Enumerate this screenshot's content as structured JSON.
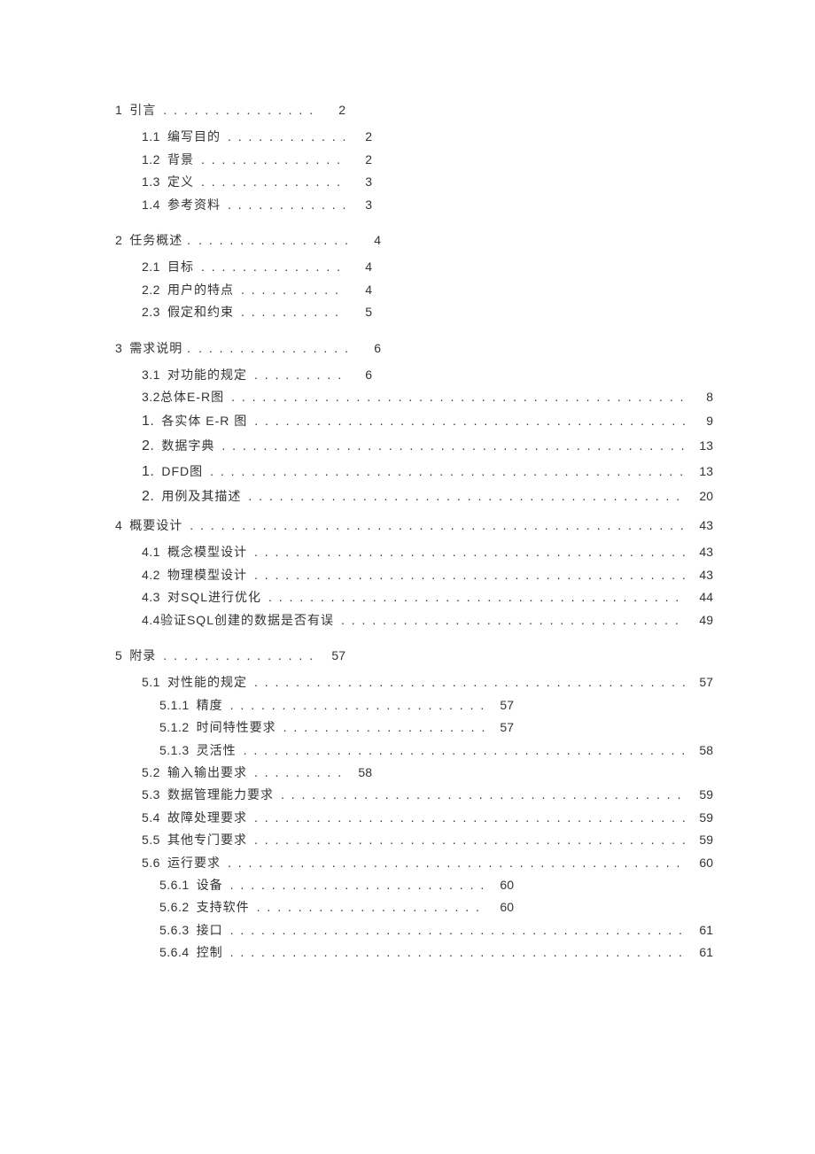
{
  "toc": [
    {
      "level": 0,
      "width": "short",
      "num": "1",
      "title": "引言",
      "page": "2",
      "gap": ""
    },
    {
      "level": 1,
      "width": "short",
      "num": "1.1",
      "title": "编写目的",
      "page": "2",
      "gap": "sub"
    },
    {
      "level": 1,
      "width": "short",
      "num": "1.2",
      "title": "背景",
      "page": "2",
      "gap": ""
    },
    {
      "level": 1,
      "width": "short",
      "num": "1.3",
      "title": "定义",
      "page": "3",
      "gap": ""
    },
    {
      "level": 1,
      "width": "short",
      "num": "1.4",
      "title": "参考资料",
      "page": "3",
      "gap": ""
    },
    {
      "level": 0,
      "width": "short2",
      "num": "2",
      "title": "任务概述 .",
      "page": "4",
      "gap": "section"
    },
    {
      "level": 1,
      "width": "short",
      "num": "2.1",
      "title": "目标",
      "page": "4",
      "gap": "sub"
    },
    {
      "level": 1,
      "width": "short",
      "num": "2.2",
      "title": "用户的特点",
      "page": "4",
      "gap": ""
    },
    {
      "level": 1,
      "width": "short",
      "num": "2.3",
      "title": "假定和约束",
      "page": "5",
      "gap": ""
    },
    {
      "level": 0,
      "width": "short2",
      "num": "3",
      "title": "需求说明 .",
      "page": "6",
      "gap": "section"
    },
    {
      "level": 1,
      "width": "short",
      "num": "3.1",
      "title": "对功能的规定",
      "page": "6",
      "gap": "sub"
    },
    {
      "level": 1,
      "width": "full",
      "num": "3.2",
      "title": "总体E-R图",
      "nospace": true,
      "page": "8",
      "gap": ""
    },
    {
      "level": 1,
      "width": "full",
      "num": "1.",
      "title": "各实体 E-R 图",
      "page": "9",
      "gap": "",
      "big": true
    },
    {
      "level": 1,
      "width": "full",
      "num": "2.",
      "title": "数据字典",
      "page": "13",
      "gap": "",
      "big": true
    },
    {
      "level": 1,
      "width": "full",
      "num": "1.",
      "title": "DFD图",
      "page": "13",
      "gap": "",
      "big": true
    },
    {
      "level": 1,
      "width": "full",
      "num": "2.",
      "title": "用例及其描述",
      "page": "20",
      "gap": "",
      "big": true
    },
    {
      "level": 0,
      "width": "full",
      "num": "4",
      "title": "概要设计",
      "page": "43",
      "gap": "sub"
    },
    {
      "level": 1,
      "width": "full",
      "num": "4.1",
      "title": "概念模型设计",
      "page": "43",
      "gap": "sub"
    },
    {
      "level": 1,
      "width": "full",
      "num": "4.2",
      "title": "物理模型设计",
      "page": "43",
      "gap": ""
    },
    {
      "level": 1,
      "width": "full",
      "num": "4.3",
      "title": "对SQL进行优化",
      "page": "44",
      "gap": ""
    },
    {
      "level": 1,
      "width": "full",
      "num": "4.4",
      "title": "验证SQL创建的数据是否有误",
      "nospace": true,
      "page": "49",
      "gap": ""
    },
    {
      "level": 0,
      "width": "short",
      "num": "5",
      "title": "附录",
      "page": "57",
      "gap": "section"
    },
    {
      "level": 1,
      "width": "full",
      "num": "5.1",
      "title": "对性能的规定",
      "page": "57",
      "gap": "sub"
    },
    {
      "level": 2,
      "width": "mid",
      "num": "5.1.1",
      "title": "精度",
      "page": "57",
      "gap": ""
    },
    {
      "level": 2,
      "width": "mid",
      "num": "5.1.2",
      "title": "时间特性要求",
      "page": "57",
      "gap": ""
    },
    {
      "level": 2,
      "width": "full",
      "num": "5.1.3",
      "title": "灵活性",
      "page": "58",
      "gap": ""
    },
    {
      "level": 1,
      "width": "short",
      "num": "5.2",
      "title": "输入输出要求",
      "page": "58",
      "gap": ""
    },
    {
      "level": 1,
      "width": "full",
      "num": "5.3",
      "title": "数据管理能力要求",
      "page": "59",
      "gap": ""
    },
    {
      "level": 1,
      "width": "full",
      "num": "5.4",
      "title": "故障处理要求",
      "page": "59",
      "gap": ""
    },
    {
      "level": 1,
      "width": "full",
      "num": "5.5",
      "title": "其他专门要求",
      "page": "59",
      "gap": ""
    },
    {
      "level": 1,
      "width": "full",
      "num": "5.6",
      "title": "运行要求",
      "page": "60",
      "gap": ""
    },
    {
      "level": 2,
      "width": "mid",
      "num": "5.6.1",
      "title": "设备",
      "page": "60",
      "gap": ""
    },
    {
      "level": 2,
      "width": "mid",
      "num": "5.6.2",
      "title": "支持软件",
      "page": "60",
      "gap": ""
    },
    {
      "level": 2,
      "width": "full",
      "num": "5.6.3",
      "title": "接口",
      "page": "61",
      "gap": ""
    },
    {
      "level": 2,
      "width": "full",
      "num": "5.6.4",
      "title": "控制",
      "page": "61",
      "gap": ""
    }
  ]
}
